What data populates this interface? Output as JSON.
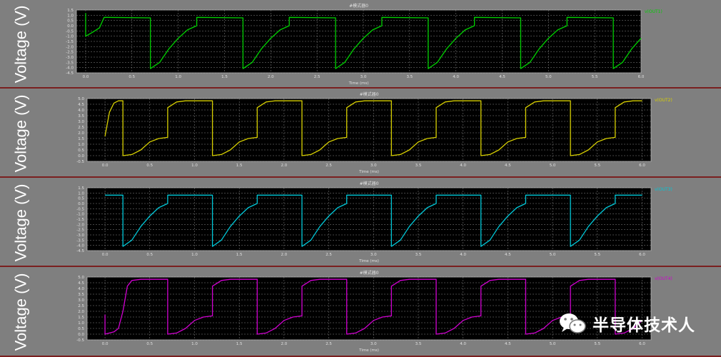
{
  "ylabel": "Voltage (V)",
  "watermark": {
    "text": "半导体技术人",
    "icon": "wechat-icon"
  },
  "colors": {
    "plot_bg": "#000000",
    "grid": "#8a8a8a",
    "axis_text": "#e0e0e0",
    "panel_bg": "#7f7f7f",
    "separator": "#7a1f1f"
  },
  "chart_data": [
    {
      "type": "line",
      "title": "#模式器0",
      "xlabel": "Time (ms)",
      "legend": "v(OUT1)",
      "color": "#00d000",
      "xlim": [
        -0.1,
        6.0
      ],
      "ylim": [
        -4.5,
        1.5
      ],
      "xticks": [
        "0.0",
        "0.5",
        "1.0",
        "1.5",
        "2.0",
        "2.5",
        "3.0",
        "3.5",
        "4.0",
        "4.5",
        "5.0",
        "5.5",
        "6.0"
      ],
      "yticks": [
        "1.5",
        "1.0",
        "0.5",
        "0.0",
        "-0.5",
        "-1.0",
        "-1.5",
        "-2.0",
        "-2.5",
        "-3.0",
        "-3.5",
        "-4.0",
        "-4.5"
      ],
      "grid": true,
      "legend_position": "top-right",
      "points": [
        [
          0.0,
          1.2
        ],
        [
          0.0,
          -1.0
        ],
        [
          0.08,
          -0.6
        ],
        [
          0.15,
          -0.2
        ],
        [
          0.2,
          0.8
        ],
        [
          0.22,
          0.8
        ],
        [
          0.7,
          0.75
        ],
        [
          0.7,
          -4.1
        ],
        [
          0.8,
          -3.5
        ],
        [
          0.9,
          -2.2
        ],
        [
          1.0,
          -1.2
        ],
        [
          1.1,
          -0.4
        ],
        [
          1.2,
          0.0
        ],
        [
          1.2,
          0.8
        ],
        [
          1.7,
          0.75
        ],
        [
          1.7,
          -4.1
        ],
        [
          1.8,
          -3.5
        ],
        [
          1.9,
          -2.2
        ],
        [
          2.0,
          -1.2
        ],
        [
          2.1,
          -0.4
        ],
        [
          2.2,
          0.0
        ],
        [
          2.2,
          0.8
        ],
        [
          2.7,
          0.75
        ],
        [
          2.7,
          -4.1
        ],
        [
          2.8,
          -3.5
        ],
        [
          2.9,
          -2.2
        ],
        [
          3.0,
          -1.2
        ],
        [
          3.1,
          -0.4
        ],
        [
          3.2,
          0.0
        ],
        [
          3.2,
          0.8
        ],
        [
          3.7,
          0.75
        ],
        [
          3.7,
          -4.1
        ],
        [
          3.8,
          -3.5
        ],
        [
          3.9,
          -2.2
        ],
        [
          4.0,
          -1.2
        ],
        [
          4.1,
          -0.4
        ],
        [
          4.2,
          0.0
        ],
        [
          4.2,
          0.8
        ],
        [
          4.7,
          0.75
        ],
        [
          4.7,
          -4.1
        ],
        [
          4.8,
          -3.5
        ],
        [
          4.9,
          -2.2
        ],
        [
          5.0,
          -1.2
        ],
        [
          5.1,
          -0.4
        ],
        [
          5.2,
          0.0
        ],
        [
          5.2,
          0.8
        ],
        [
          5.7,
          0.75
        ],
        [
          5.7,
          -4.1
        ],
        [
          5.8,
          -3.5
        ],
        [
          5.9,
          -2.2
        ],
        [
          6.0,
          -1.2
        ]
      ]
    },
    {
      "type": "line",
      "title": "#模式器0",
      "xlabel": "Time (ms)",
      "legend": "v(OUT2)",
      "color": "#d8d000",
      "xlim": [
        -0.2,
        6.1
      ],
      "ylim": [
        -0.5,
        5.0
      ],
      "xticks": [
        "0.0",
        "0.5",
        "1.0",
        "1.5",
        "2.0",
        "2.5",
        "3.0",
        "3.5",
        "4.0",
        "4.5",
        "5.0",
        "5.5",
        "6.0"
      ],
      "yticks": [
        "5.0",
        "4.5",
        "4.0",
        "3.5",
        "3.0",
        "2.5",
        "2.0",
        "1.5",
        "1.0",
        "0.5",
        "0.0",
        "-0.5"
      ],
      "grid": true,
      "legend_position": "top-right",
      "points": [
        [
          0.0,
          1.7
        ],
        [
          0.05,
          3.8
        ],
        [
          0.1,
          4.6
        ],
        [
          0.15,
          4.8
        ],
        [
          0.2,
          4.8
        ],
        [
          0.2,
          0.0
        ],
        [
          0.3,
          0.1
        ],
        [
          0.4,
          0.5
        ],
        [
          0.5,
          1.2
        ],
        [
          0.6,
          1.5
        ],
        [
          0.7,
          1.6
        ],
        [
          0.7,
          4.2
        ],
        [
          0.8,
          4.7
        ],
        [
          0.9,
          4.8
        ],
        [
          1.2,
          4.8
        ],
        [
          1.2,
          0.0
        ],
        [
          1.3,
          0.1
        ],
        [
          1.4,
          0.5
        ],
        [
          1.5,
          1.2
        ],
        [
          1.6,
          1.5
        ],
        [
          1.7,
          1.6
        ],
        [
          1.7,
          4.2
        ],
        [
          1.8,
          4.7
        ],
        [
          1.9,
          4.8
        ],
        [
          2.2,
          4.8
        ],
        [
          2.2,
          0.0
        ],
        [
          2.3,
          0.1
        ],
        [
          2.4,
          0.5
        ],
        [
          2.5,
          1.2
        ],
        [
          2.6,
          1.5
        ],
        [
          2.7,
          1.6
        ],
        [
          2.7,
          4.2
        ],
        [
          2.8,
          4.7
        ],
        [
          2.9,
          4.8
        ],
        [
          3.2,
          4.8
        ],
        [
          3.2,
          0.0
        ],
        [
          3.3,
          0.1
        ],
        [
          3.4,
          0.5
        ],
        [
          3.5,
          1.2
        ],
        [
          3.6,
          1.5
        ],
        [
          3.7,
          1.6
        ],
        [
          3.7,
          4.2
        ],
        [
          3.8,
          4.7
        ],
        [
          3.9,
          4.8
        ],
        [
          4.2,
          4.8
        ],
        [
          4.2,
          0.0
        ],
        [
          4.3,
          0.1
        ],
        [
          4.4,
          0.5
        ],
        [
          4.5,
          1.2
        ],
        [
          4.6,
          1.5
        ],
        [
          4.7,
          1.6
        ],
        [
          4.7,
          4.2
        ],
        [
          4.8,
          4.7
        ],
        [
          4.9,
          4.8
        ],
        [
          5.2,
          4.8
        ],
        [
          5.2,
          0.0
        ],
        [
          5.3,
          0.1
        ],
        [
          5.4,
          0.5
        ],
        [
          5.5,
          1.2
        ],
        [
          5.6,
          1.5
        ],
        [
          5.7,
          1.6
        ],
        [
          5.7,
          4.2
        ],
        [
          5.8,
          4.7
        ],
        [
          5.9,
          4.8
        ],
        [
          6.0,
          4.8
        ]
      ]
    },
    {
      "type": "line",
      "title": "#模式器0",
      "xlabel": "Time (ms)",
      "legend": "v(OUT3)",
      "color": "#00c8d8",
      "xlim": [
        -0.2,
        6.1
      ],
      "ylim": [
        -4.5,
        1.5
      ],
      "xticks": [
        "0.0",
        "0.5",
        "1.0",
        "1.5",
        "2.0",
        "2.5",
        "3.0",
        "3.5",
        "4.0",
        "4.5",
        "5.0",
        "5.5",
        "6.0"
      ],
      "yticks": [
        "1.5",
        "1.0",
        "0.5",
        "0.0",
        "-0.5",
        "-1.0",
        "-1.5",
        "-2.0",
        "-2.5",
        "-3.0",
        "-3.5",
        "-4.0",
        "-4.5"
      ],
      "grid": true,
      "legend_position": "top-right",
      "points": [
        [
          0.0,
          0.8
        ],
        [
          0.2,
          0.8
        ],
        [
          0.2,
          -4.1
        ],
        [
          0.3,
          -3.5
        ],
        [
          0.4,
          -2.2
        ],
        [
          0.5,
          -1.2
        ],
        [
          0.6,
          -0.4
        ],
        [
          0.7,
          0.0
        ],
        [
          0.7,
          0.8
        ],
        [
          1.2,
          0.8
        ],
        [
          1.2,
          -4.1
        ],
        [
          1.3,
          -3.5
        ],
        [
          1.4,
          -2.2
        ],
        [
          1.5,
          -1.2
        ],
        [
          1.6,
          -0.4
        ],
        [
          1.7,
          0.0
        ],
        [
          1.7,
          0.8
        ],
        [
          2.2,
          0.8
        ],
        [
          2.2,
          -4.1
        ],
        [
          2.3,
          -3.5
        ],
        [
          2.4,
          -2.2
        ],
        [
          2.5,
          -1.2
        ],
        [
          2.6,
          -0.4
        ],
        [
          2.7,
          0.0
        ],
        [
          2.7,
          0.8
        ],
        [
          3.2,
          0.8
        ],
        [
          3.2,
          -4.1
        ],
        [
          3.3,
          -3.5
        ],
        [
          3.4,
          -2.2
        ],
        [
          3.5,
          -1.2
        ],
        [
          3.6,
          -0.4
        ],
        [
          3.7,
          0.0
        ],
        [
          3.7,
          0.8
        ],
        [
          4.2,
          0.8
        ],
        [
          4.2,
          -4.1
        ],
        [
          4.3,
          -3.5
        ],
        [
          4.4,
          -2.2
        ],
        [
          4.5,
          -1.2
        ],
        [
          4.6,
          -0.4
        ],
        [
          4.7,
          0.0
        ],
        [
          4.7,
          0.8
        ],
        [
          5.2,
          0.8
        ],
        [
          5.2,
          -4.1
        ],
        [
          5.3,
          -3.5
        ],
        [
          5.4,
          -2.2
        ],
        [
          5.5,
          -1.2
        ],
        [
          5.6,
          -0.4
        ],
        [
          5.7,
          0.0
        ],
        [
          5.7,
          0.8
        ],
        [
          6.0,
          0.8
        ]
      ]
    },
    {
      "type": "line",
      "title": "#模式器0",
      "xlabel": "Time (ms)",
      "legend": "v(OUT4)",
      "color": "#d000d0",
      "xlim": [
        -0.2,
        6.1
      ],
      "ylim": [
        -0.5,
        5.0
      ],
      "xticks": [
        "0.0",
        "0.5",
        "1.0",
        "1.5",
        "2.0",
        "2.5",
        "3.0",
        "3.5",
        "4.0",
        "4.5",
        "5.0",
        "5.5",
        "6.0"
      ],
      "yticks": [
        "5.0",
        "4.5",
        "4.0",
        "3.5",
        "3.0",
        "2.5",
        "2.0",
        "1.5",
        "1.0",
        "0.5",
        "0.0",
        "-0.5"
      ],
      "grid": true,
      "legend_position": "top-right",
      "points": [
        [
          0.0,
          1.7
        ],
        [
          0.0,
          0.0
        ],
        [
          0.1,
          0.2
        ],
        [
          0.15,
          0.5
        ],
        [
          0.2,
          2.0
        ],
        [
          0.25,
          4.2
        ],
        [
          0.3,
          4.7
        ],
        [
          0.4,
          4.8
        ],
        [
          0.7,
          4.8
        ],
        [
          0.7,
          0.0
        ],
        [
          0.8,
          0.1
        ],
        [
          0.9,
          0.5
        ],
        [
          1.0,
          1.2
        ],
        [
          1.1,
          1.5
        ],
        [
          1.2,
          1.6
        ],
        [
          1.2,
          4.2
        ],
        [
          1.3,
          4.7
        ],
        [
          1.4,
          4.8
        ],
        [
          1.7,
          4.8
        ],
        [
          1.7,
          0.0
        ],
        [
          1.8,
          0.1
        ],
        [
          1.9,
          0.5
        ],
        [
          2.0,
          1.2
        ],
        [
          2.1,
          1.5
        ],
        [
          2.2,
          1.6
        ],
        [
          2.2,
          4.2
        ],
        [
          2.3,
          4.7
        ],
        [
          2.4,
          4.8
        ],
        [
          2.7,
          4.8
        ],
        [
          2.7,
          0.0
        ],
        [
          2.8,
          0.1
        ],
        [
          2.9,
          0.5
        ],
        [
          3.0,
          1.2
        ],
        [
          3.1,
          1.5
        ],
        [
          3.2,
          1.6
        ],
        [
          3.2,
          4.2
        ],
        [
          3.3,
          4.7
        ],
        [
          3.4,
          4.8
        ],
        [
          3.7,
          4.8
        ],
        [
          3.7,
          0.0
        ],
        [
          3.8,
          0.1
        ],
        [
          3.9,
          0.5
        ],
        [
          4.0,
          1.2
        ],
        [
          4.1,
          1.5
        ],
        [
          4.2,
          1.6
        ],
        [
          4.2,
          4.2
        ],
        [
          4.3,
          4.7
        ],
        [
          4.4,
          4.8
        ],
        [
          4.7,
          4.8
        ],
        [
          4.7,
          0.0
        ],
        [
          4.8,
          0.1
        ],
        [
          4.9,
          0.5
        ],
        [
          5.0,
          1.2
        ],
        [
          5.1,
          1.5
        ],
        [
          5.2,
          1.6
        ],
        [
          5.2,
          4.2
        ],
        [
          5.3,
          4.7
        ],
        [
          5.4,
          4.8
        ],
        [
          5.7,
          4.8
        ],
        [
          5.7,
          0.0
        ],
        [
          5.8,
          0.1
        ],
        [
          5.9,
          0.5
        ],
        [
          6.0,
          1.2
        ]
      ]
    }
  ]
}
